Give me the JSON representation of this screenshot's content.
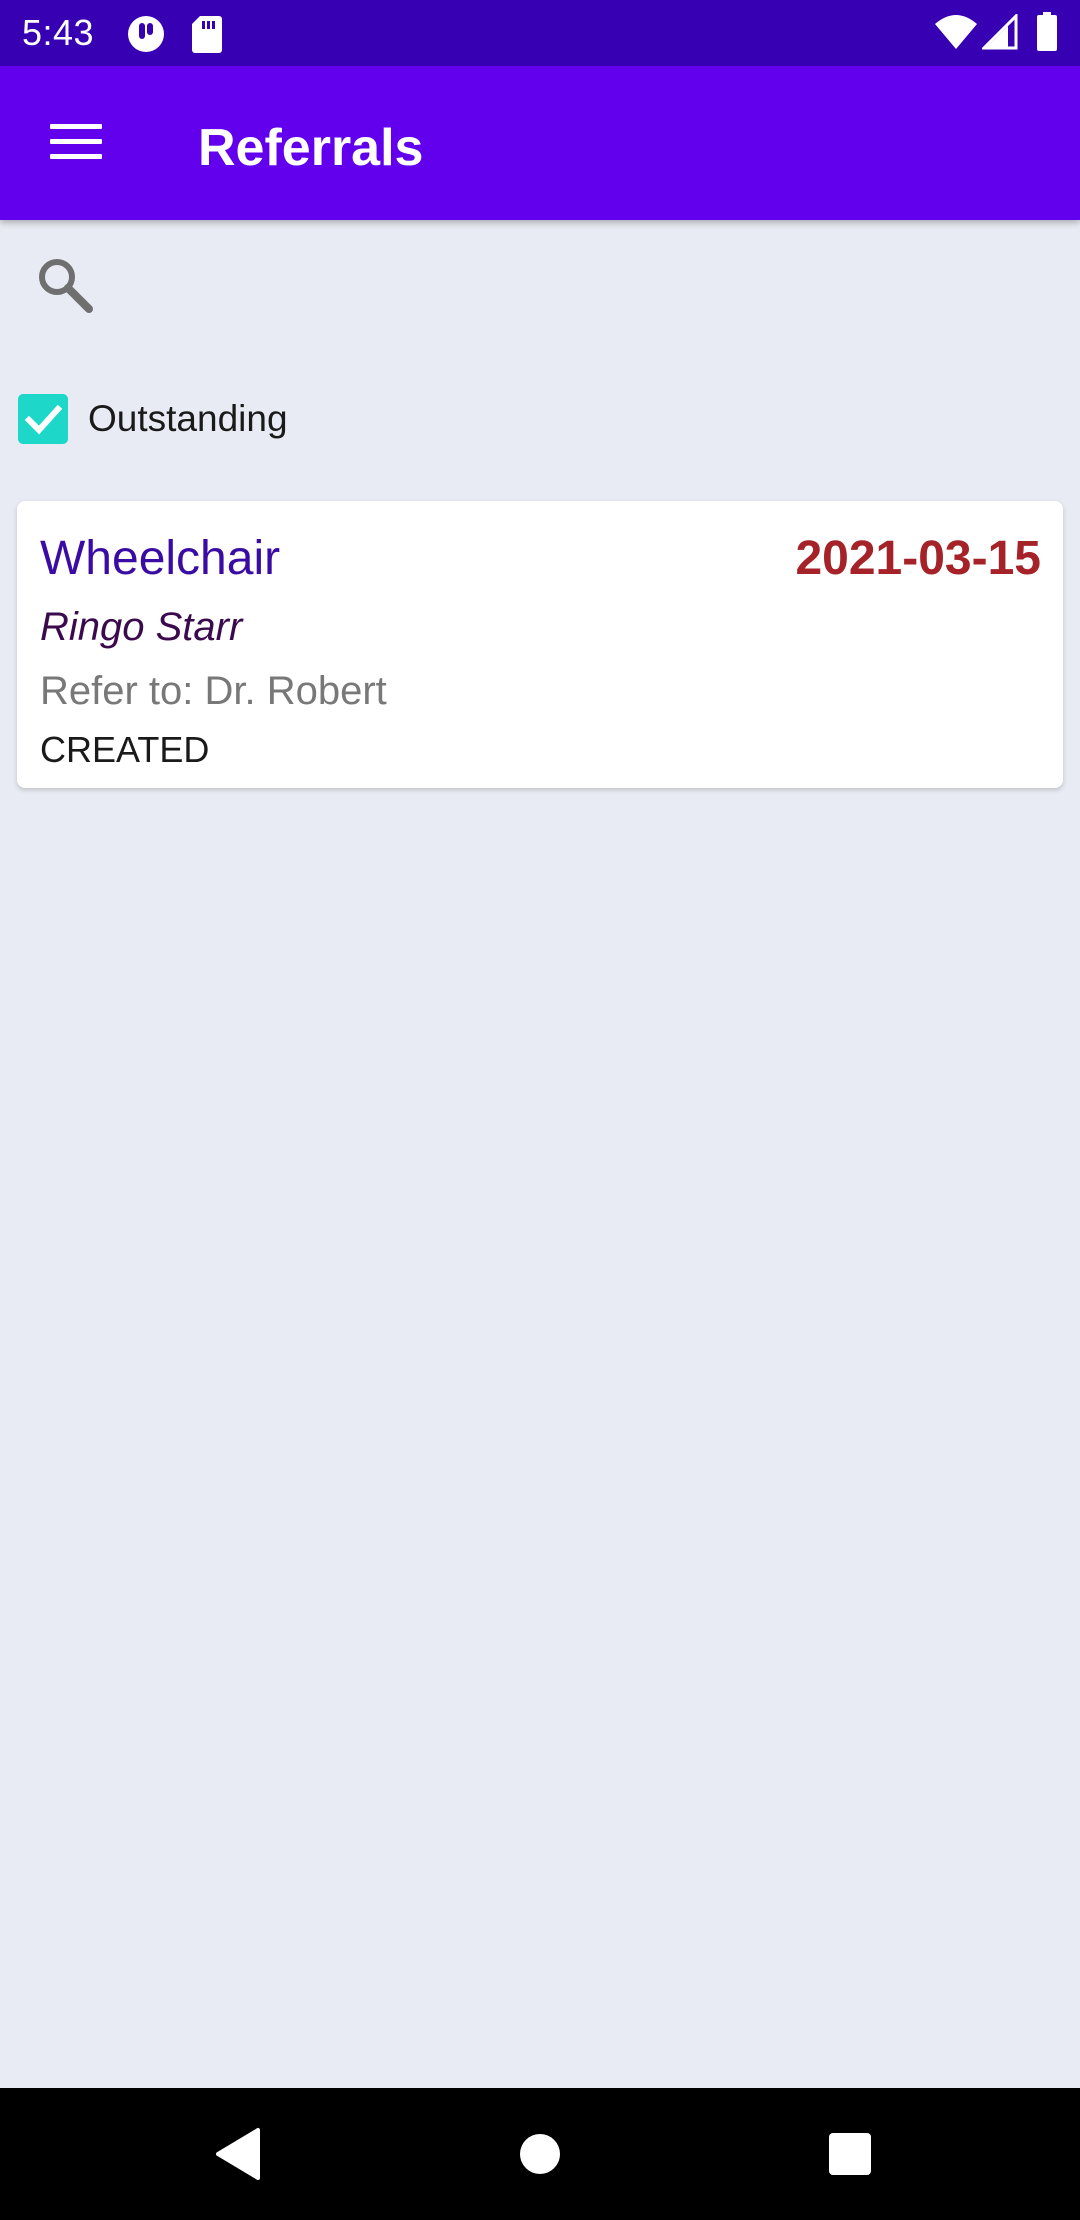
{
  "status_bar": {
    "time": "5:43",
    "icons": [
      "notification-p-icon",
      "sd-card-icon",
      "wifi-icon",
      "cell-signal-icon",
      "battery-icon"
    ]
  },
  "app_bar": {
    "title": "Referrals",
    "menu_icon": "hamburger-menu-icon",
    "background": "#6200EE"
  },
  "search": {
    "icon": "search-icon"
  },
  "filter": {
    "label": "Outstanding",
    "checked": true,
    "checkbox_color": "#1DD8C9"
  },
  "referrals": [
    {
      "title": "Wheelchair",
      "date": "2021-03-15",
      "patient": "Ringo Starr",
      "refer_to": "Refer to: Dr. Robert",
      "status": "CREATED"
    }
  ],
  "nav_bar": {
    "buttons": [
      "back-icon",
      "home-icon",
      "recents-icon"
    ]
  },
  "colors": {
    "status_bar": "#3700B3",
    "background": "#E8EBF3",
    "title_text": "#3A0CA3",
    "date_text": "#A42228"
  }
}
